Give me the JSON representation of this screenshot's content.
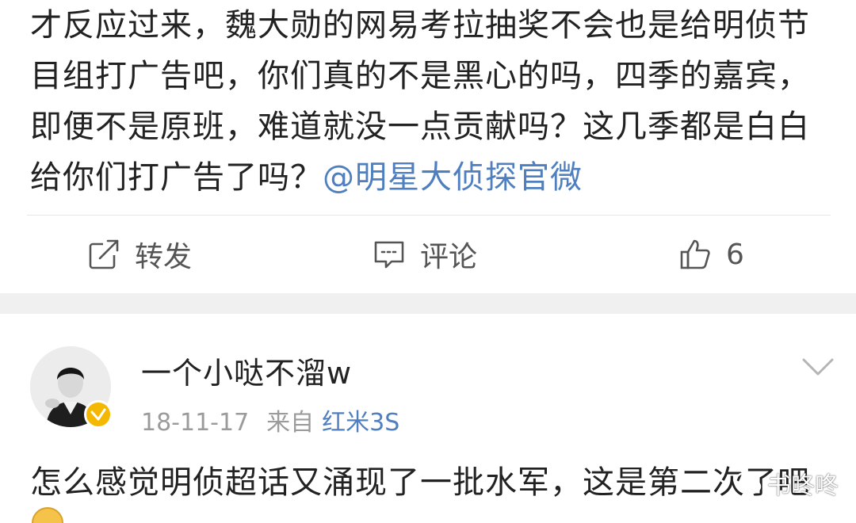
{
  "post1": {
    "text_before_mention": "才反应过来，魏大勋的网易考拉抽奖不会也是给明侦节目组打广告吧，你们真的不是黑心的吗，四季的嘉宾，即便不是原班，难道就没一点贡献吗？这几季都是白白给你们打广告了吗？",
    "mention": "@明星大侦探官微"
  },
  "actions": {
    "repost_label": "转发",
    "comment_label": "评论",
    "like_count": "6"
  },
  "post2": {
    "username": "一个小哒不溜w",
    "date": "18-11-17",
    "source_prefix": "来自",
    "source_device": "红米3S",
    "text": "怎么感觉明侦超话又涌现了一批水军，这是第二次了吧"
  },
  "watermark": {
    "text": "书咚咚"
  },
  "colors": {
    "link": "#4f7fbf",
    "text": "#222222",
    "meta": "#9b9b9b",
    "badge": "#f5b800",
    "separator": "#f0f0f0"
  }
}
